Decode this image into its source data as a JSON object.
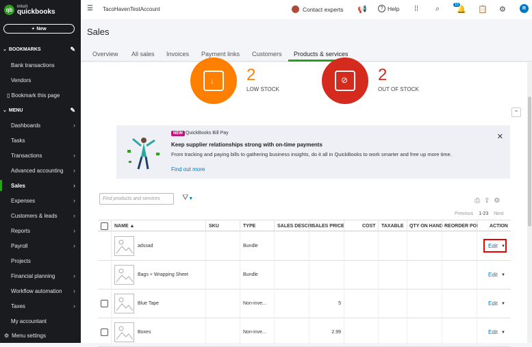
{
  "sidebar": {
    "logo_top": "intuit",
    "logo_main": "quickbooks",
    "new_label": "New",
    "bookmarks_label": "BOOKMARKS",
    "bookmarks": [
      "Bank transactions",
      "Vendors",
      "Bookmark this page"
    ],
    "menu_label": "MENU",
    "menu": [
      {
        "label": "Dashboards",
        "chevron": true
      },
      {
        "label": "Tasks",
        "chevron": false
      },
      {
        "label": "Transactions",
        "chevron": true
      },
      {
        "label": "Advanced accounting",
        "chevron": true
      },
      {
        "label": "Sales",
        "chevron": true
      },
      {
        "label": "Expenses",
        "chevron": true
      },
      {
        "label": "Customers & leads",
        "chevron": true
      },
      {
        "label": "Reports",
        "chevron": true
      },
      {
        "label": "Payroll",
        "chevron": true
      },
      {
        "label": "Projects",
        "chevron": false
      },
      {
        "label": "Financial planning",
        "chevron": true
      },
      {
        "label": "Workflow automation",
        "chevron": true
      },
      {
        "label": "Taxes",
        "chevron": true
      },
      {
        "label": "My accountant",
        "chevron": false
      }
    ],
    "menu_settings": "Menu settings"
  },
  "topbar": {
    "company": "TacoHavenTestAccount",
    "contact": "Contact experts",
    "help": "Help",
    "notif_count": "15",
    "user_initial": "R"
  },
  "page": {
    "title": "Sales",
    "tabs": [
      "Overview",
      "All sales",
      "Invoices",
      "Payment links",
      "Customers",
      "Products & services"
    ],
    "active_tab": "Products & services"
  },
  "stats": {
    "low_stock_count": "2",
    "low_stock_label": "LOW STOCK",
    "out_of_stock_count": "2",
    "out_of_stock_label": "OUT OF STOCK"
  },
  "promo": {
    "tag": "NEW",
    "product": "QuickBooks Bill Pay",
    "headline": "Keep supplier relationships strong with on-time payments",
    "body": "From tracking and paying bills to gathering business insights, do it all in QuickBooks to work smarter and free up more time.",
    "link": "Find out more"
  },
  "table": {
    "search_placeholder": "Find products and services",
    "pager": {
      "previous": "Previous",
      "range": "1-23",
      "next": "Next"
    },
    "headers": [
      "NAME ▲",
      "SKU",
      "TYPE",
      "SALES DESCRI",
      "SALES PRICE",
      "COST",
      "TAXABLE",
      "QTY ON HAND",
      "REORDER POI",
      "ACTION"
    ],
    "rows": [
      {
        "name": "adssad",
        "type": "Bundle",
        "price": "",
        "checkbox": false,
        "action": "Edit"
      },
      {
        "name": "Bags + Wrapping Sheet",
        "type": "Bundle",
        "price": "",
        "checkbox": false,
        "action": "Edit"
      },
      {
        "name": "Blue Tape",
        "type": "Non-inve...",
        "price": "5",
        "checkbox": true,
        "action": "Edit"
      },
      {
        "name": "Boxes",
        "type": "Non-inve...",
        "price": "2.99",
        "checkbox": true,
        "action": "Edit"
      }
    ]
  },
  "colors": {
    "brand_green": "#2ca01c",
    "link_blue": "#0077c5",
    "orange": "#ff8000",
    "red": "#d52b1e",
    "highlight": "#e00000"
  }
}
